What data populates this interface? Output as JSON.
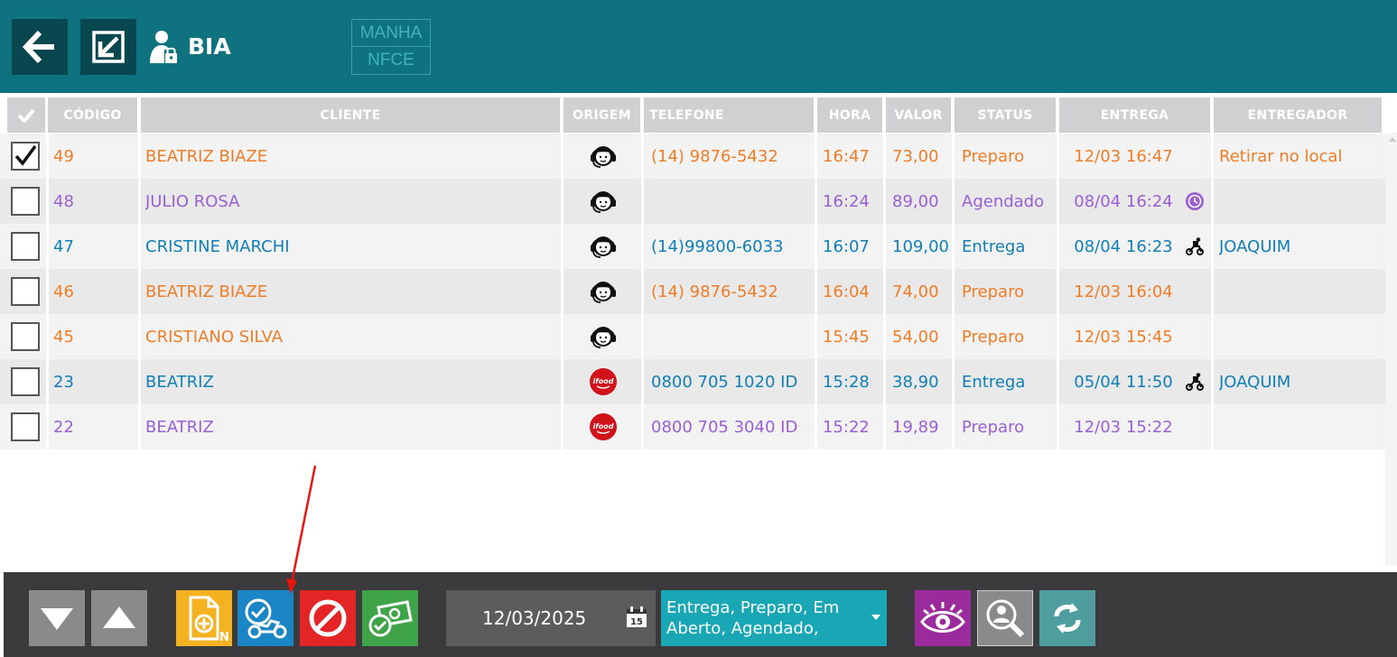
{
  "header": {
    "user_name": "BIA",
    "tag_line1": "MANHA",
    "tag_line2": "NFCE",
    "background_color": "#0e737e"
  },
  "table": {
    "columns": [
      "CÓDIGO",
      "CLIENTE",
      "ORIGEM",
      "TELEFONE",
      "HORA",
      "VALOR",
      "STATUS",
      "ENTREGA",
      "ENTREGADOR"
    ],
    "rows": [
      {
        "checked": true,
        "codigo": "49",
        "cliente": "BEATRIZ BIAZE",
        "origem": "headset-icon",
        "telefone": "(14) 9876-5432",
        "hora": "16:47",
        "valor": "73,00",
        "status": "Preparo",
        "entrega": "12/03 16:47",
        "entrega_icon": "",
        "entregador": "Retirar no local",
        "color": "#ef7d27"
      },
      {
        "checked": false,
        "codigo": "48",
        "cliente": "JULIO ROSA",
        "origem": "headset-icon",
        "telefone": "",
        "hora": "16:24",
        "valor": "89,00",
        "status": "Agendado",
        "entrega": "08/04 16:24",
        "entrega_icon": "clock-icon",
        "entregador": "",
        "color": "#9a5fd2"
      },
      {
        "checked": false,
        "codigo": "47",
        "cliente": "CRISTINE MARCHI",
        "origem": "headset-icon",
        "telefone": "(14)99800-6033",
        "hora": "16:07",
        "valor": "109,00",
        "status": "Entrega",
        "entrega": "08/04 16:23",
        "entrega_icon": "motorcycle-icon",
        "entregador": "JOAQUIM",
        "color": "#107fb6"
      },
      {
        "checked": false,
        "codigo": "46",
        "cliente": "BEATRIZ BIAZE",
        "origem": "headset-icon",
        "telefone": "(14) 9876-5432",
        "hora": "16:04",
        "valor": "74,00",
        "status": "Preparo",
        "entrega": "12/03 16:04",
        "entrega_icon": "",
        "entregador": "",
        "color": "#ef7d27"
      },
      {
        "checked": false,
        "codigo": "45",
        "cliente": "CRISTIANO SILVA",
        "origem": "headset-icon",
        "telefone": "",
        "hora": "15:45",
        "valor": "54,00",
        "status": "Preparo",
        "entrega": "12/03 15:45",
        "entrega_icon": "",
        "entregador": "",
        "color": "#ef7d27"
      },
      {
        "checked": false,
        "codigo": "23",
        "cliente": "BEATRIZ",
        "origem": "ifood-icon",
        "telefone": "0800 705 1020 ID",
        "hora": "15:28",
        "valor": "38,90",
        "status": "Entrega",
        "entrega": "05/04 11:50",
        "entrega_icon": "motorcycle-icon",
        "entregador": "JOAQUIM",
        "color": "#107fb6"
      },
      {
        "checked": false,
        "codigo": "22",
        "cliente": "BEATRIZ",
        "origem": "ifood-icon",
        "telefone": "0800 705 3040 ID",
        "hora": "15:22",
        "valor": "19,89",
        "status": "Preparo",
        "entrega": "12/03 15:22",
        "entrega_icon": "",
        "entregador": "",
        "color": "#9a5fd2"
      }
    ]
  },
  "footer": {
    "date": "12/03/2025",
    "calendar_day": "15",
    "status_filter": "Entrega, Preparo, Em Aberto, Agendado,",
    "new_order_badge": "N",
    "ifood_label": "ifood"
  }
}
